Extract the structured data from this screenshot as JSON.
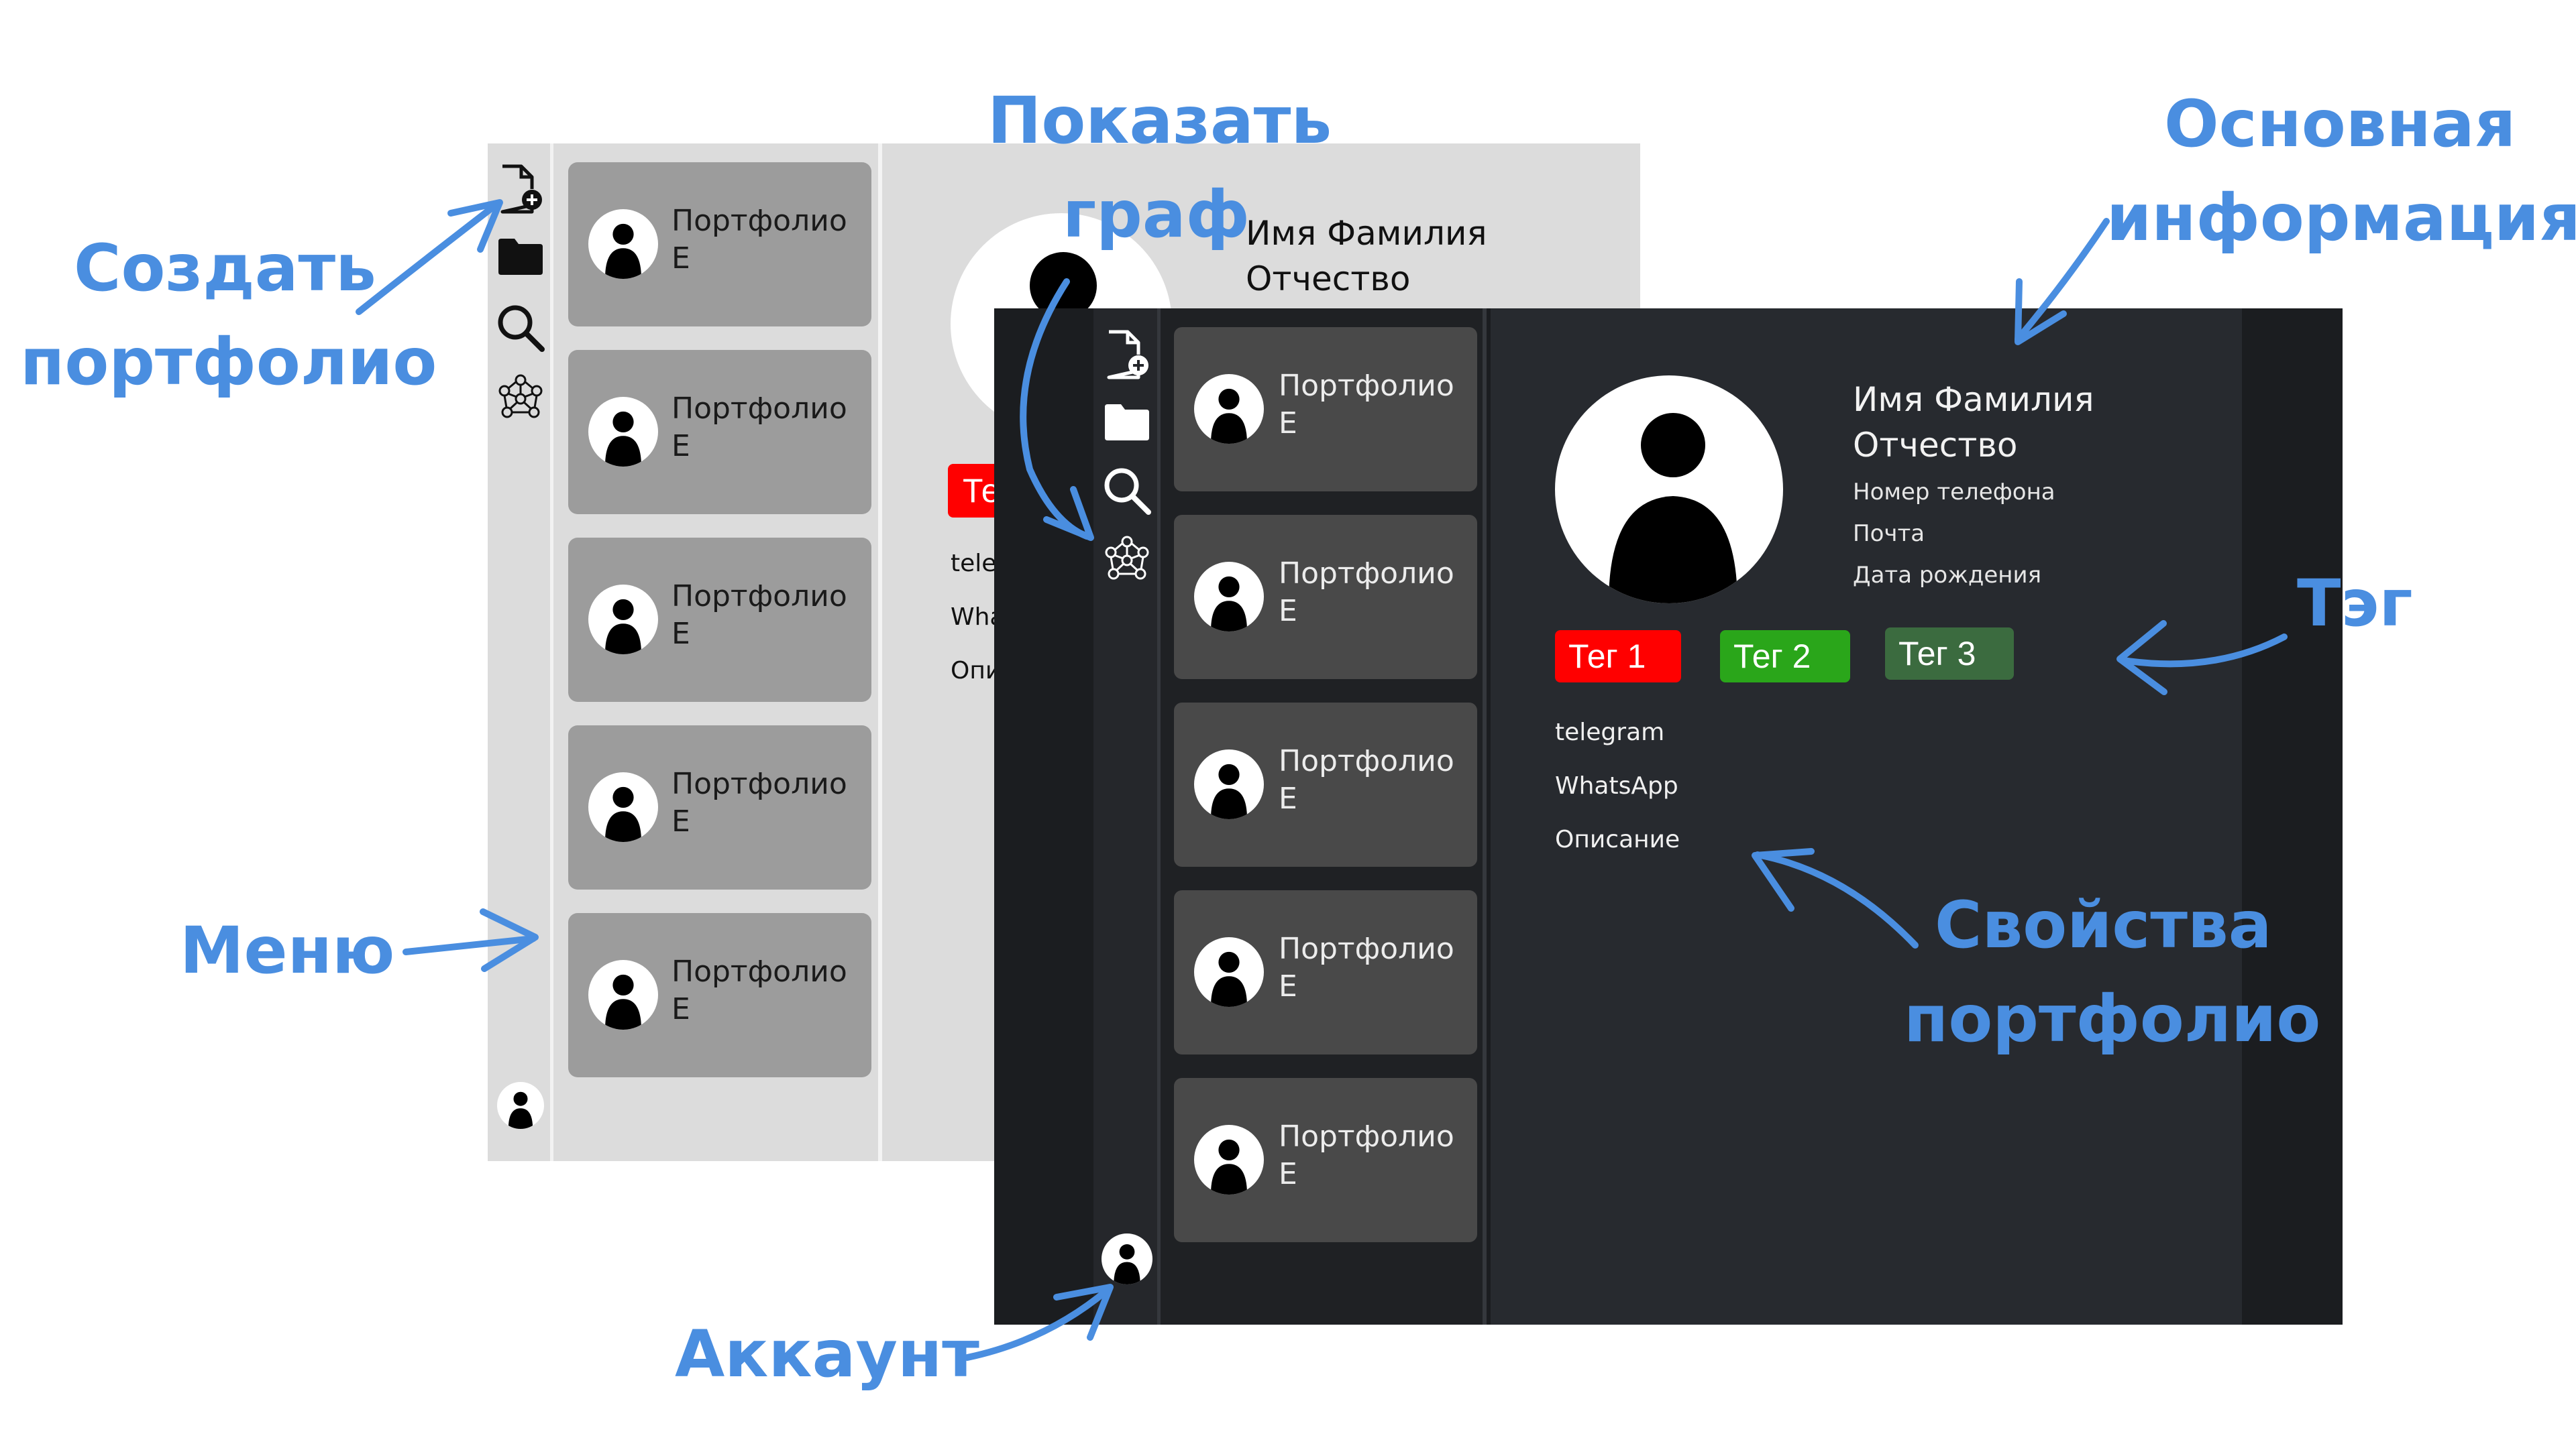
{
  "colors": {
    "annotation": "#4a8ee0",
    "light_bg": "#dcdcdc",
    "light_card": "#9c9c9c",
    "dark_bg": "#1b1d20",
    "dark_card": "#494949",
    "tag1": "#ff0000",
    "tag2": "#2aa61a",
    "tag3": "#3b6b3f"
  },
  "sidebar_icons": [
    "create-document-icon",
    "folder-icon",
    "search-icon",
    "graph-icon"
  ],
  "portfolio_items": [
    {
      "line1": "Портфолио",
      "line2": "Е"
    },
    {
      "line1": "Портфолио",
      "line2": "Е"
    },
    {
      "line1": "Портфолио",
      "line2": "Е"
    },
    {
      "line1": "Портфолио",
      "line2": "Е"
    },
    {
      "line1": "Портфолио",
      "line2": "Е"
    }
  ],
  "light_window": {
    "name_line1": "Имя Фамилия",
    "name_line2": "Отчество",
    "tag_partial": "Те",
    "prop_partial_1": "tele",
    "prop_partial_2": "Wha",
    "prop_partial_3": "Опи"
  },
  "dark_window": {
    "name_line1": "Имя Фамилия",
    "name_line2": "Отчество",
    "phone": "Номер телефона",
    "email": "Почта",
    "birthdate": "Дата рождения",
    "tags": [
      {
        "label": "Тег 1",
        "color": "#ff0000"
      },
      {
        "label": "Тег 2",
        "color": "#2aa61a"
      },
      {
        "label": "Тег 3",
        "color": "#3b6b3f"
      }
    ],
    "properties": [
      "telegram",
      "WhatsApp",
      "Описание"
    ]
  },
  "annotations": {
    "create_portfolio": [
      "Создать",
      "портфолио"
    ],
    "show_graph": [
      "Показать",
      "граф"
    ],
    "main_info": [
      "Основная",
      "информация"
    ],
    "tag": "Тэг",
    "menu": "Меню",
    "properties": [
      "Свойства",
      "портфолио"
    ],
    "account": "Аккаунт"
  }
}
